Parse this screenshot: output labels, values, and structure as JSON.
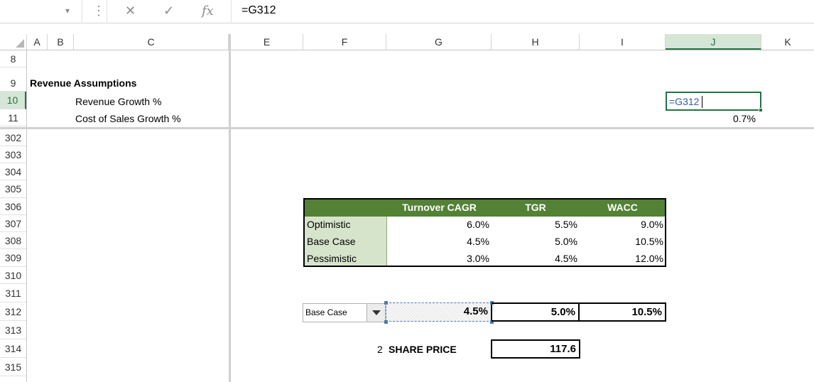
{
  "formula_bar": {
    "name_box_arrow": "▾",
    "dots": "⋮",
    "cancel_glyph": "✕",
    "enter_glyph": "✓",
    "fx_label": "fx",
    "formula": "=G312"
  },
  "columns": [
    "A",
    "B",
    "C",
    "E",
    "F",
    "G",
    "H",
    "I",
    "J",
    "K"
  ],
  "selected_column": "J",
  "rows": [
    "8",
    "9",
    "10",
    "11",
    "302",
    "303",
    "304",
    "305",
    "306",
    "307",
    "308",
    "309",
    "310",
    "311",
    "312",
    "313",
    "314",
    "315"
  ],
  "selected_row": "10",
  "assumptions": {
    "heading": "Revenue Assumptions",
    "revenue_growth_label": "Revenue Growth %",
    "cost_of_sales_label": "Cost of Sales Growth %",
    "j10_editing": "=G312",
    "j11_value": "0.7%"
  },
  "scenario_table": {
    "headers": [
      "Turnover CAGR",
      "TGR",
      "WACC"
    ],
    "rows": [
      {
        "label": "Optimistic",
        "values": [
          "6.0%",
          "5.5%",
          "9.0%"
        ]
      },
      {
        "label": "Base Case",
        "values": [
          "4.5%",
          "5.0%",
          "10.5%"
        ]
      },
      {
        "label": "Pessimistic",
        "values": [
          "3.0%",
          "4.5%",
          "12.0%"
        ]
      }
    ]
  },
  "selector": {
    "dropdown_value": "Base Case",
    "results": [
      "4.5%",
      "5.0%",
      "10.5%"
    ]
  },
  "share_price": {
    "index": "2",
    "label": "SHARE PRICE",
    "value": "117.6"
  },
  "colors": {
    "header_green": "#538135",
    "label_green": "#d7e4cc",
    "excel_green": "#217346"
  }
}
